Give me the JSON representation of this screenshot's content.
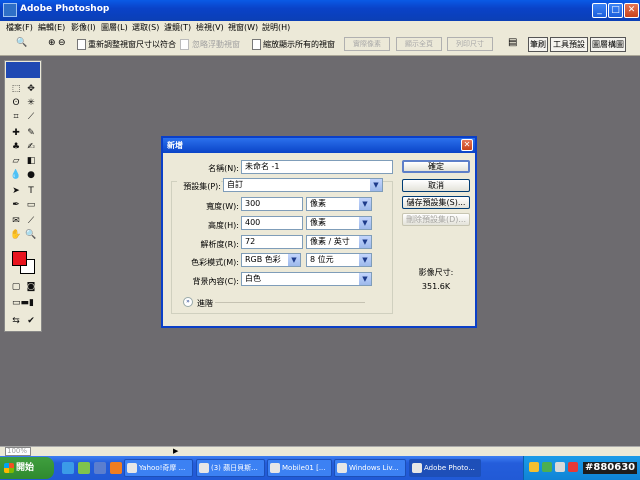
{
  "app": {
    "title": "Adobe Photoshop",
    "menu": [
      "檔案(F)",
      "編輯(E)",
      "影像(I)",
      "圖層(L)",
      "選取(S)",
      "濾鏡(T)",
      "檢視(V)",
      "視窗(W)",
      "說明(H)"
    ]
  },
  "options_bar": {
    "zoom_tool_symbol": "🔍",
    "resize_windows_label": "重新調整視窗尺寸以符合",
    "ignore_palettes_label": "忽略浮動視窗",
    "zoom_all_label": "縮放顯示所有的視窗",
    "btn_actual_pixels": "實際像素",
    "btn_fit_screen": "顯示全頁",
    "btn_print_size": "列印尺寸",
    "palette_tabs": [
      "筆刷",
      "工具預設集",
      "圖層構圖"
    ]
  },
  "dialog": {
    "title": "新增",
    "name_label": "名稱(N):",
    "name_value": "未命名 -1",
    "preset_label": "預設集(P):",
    "preset_value": "自訂",
    "width_label": "寬度(W):",
    "width_value": "300",
    "width_unit": "像素",
    "height_label": "高度(H):",
    "height_value": "400",
    "height_unit": "像素",
    "resolution_label": "解析度(R):",
    "resolution_value": "72",
    "resolution_unit": "像素 / 英寸",
    "color_mode_label": "色彩模式(M):",
    "color_mode_value": "RGB 色彩",
    "bit_depth_value": "8 位元",
    "background_label": "背景內容(C):",
    "background_value": "白色",
    "advanced_label": "進階",
    "ok_label": "確定",
    "cancel_label": "取消",
    "save_preset_label": "儲存預設集(S)...",
    "delete_preset_label": "刪除預設集(D)...",
    "image_size_label": "影像尺寸:",
    "image_size_value": "351.6K"
  },
  "status": {
    "zoom": "100%"
  },
  "taskbar": {
    "start_label": "開始",
    "tasks": [
      "Yahoo!奇摩 ...",
      "(3) 蘋日貝斯...",
      "Mobile01 [...",
      "Windows Liv...",
      "Adobe Photo..."
    ],
    "clock": "#880630"
  }
}
